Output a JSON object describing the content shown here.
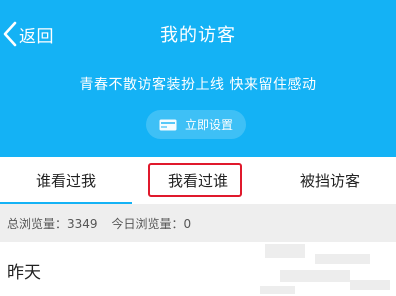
{
  "header": {
    "back_label": "返回",
    "title": "我的访客",
    "promo_text": "青春不散访客装扮上线 快来留住感动",
    "setup_button_label": "立即设置",
    "background_color": "#14b2f5"
  },
  "tabs": [
    {
      "label": "谁看过我",
      "active": true
    },
    {
      "label": "我看过谁",
      "active": false,
      "highlighted": true
    },
    {
      "label": "被挡访客",
      "active": false
    }
  ],
  "stats": {
    "total_views": "总浏览量：3349",
    "today_views": "今日浏览量：0"
  },
  "list": {
    "section_label": "昨天"
  },
  "icons": {
    "back": "chevron-left-icon",
    "setup": "card-icon"
  },
  "colors": {
    "accent": "#14b2f5",
    "highlight_border": "#e0192c",
    "stats_background": "#eeeeee"
  }
}
